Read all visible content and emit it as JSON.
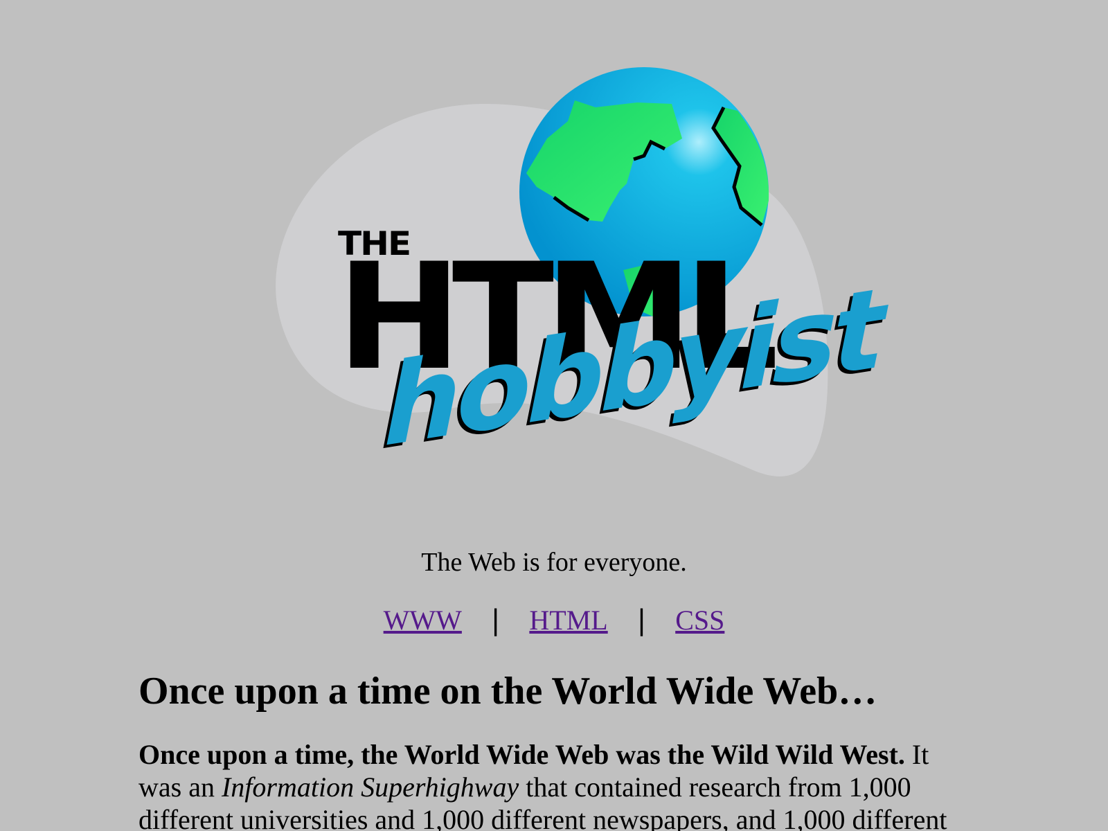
{
  "logo": {
    "the": "THE",
    "html": "HTML",
    "hobbyist": "hobbyist",
    "colors": {
      "ocean": "#04b2df",
      "land": "#22e86a",
      "script": "#1a9fcf",
      "blob": "#cfcfd1"
    }
  },
  "tagline": "The Web is for everyone.",
  "nav": {
    "links": [
      "WWW",
      "HTML",
      "CSS"
    ],
    "separator": "|"
  },
  "article": {
    "heading": "Once upon a time on the World Wide Web…",
    "intro_bold": "Once upon a time, the World Wide Web was the Wild Wild West.",
    "intro_text1": " It was an ",
    "intro_italic": "Information Superhighway",
    "intro_text2": " that contained research from 1,000 different universities and 1,000 different newspapers, and 1,000 different"
  },
  "colors": {
    "background": "#c0c0c0",
    "link": "#551a8b"
  }
}
